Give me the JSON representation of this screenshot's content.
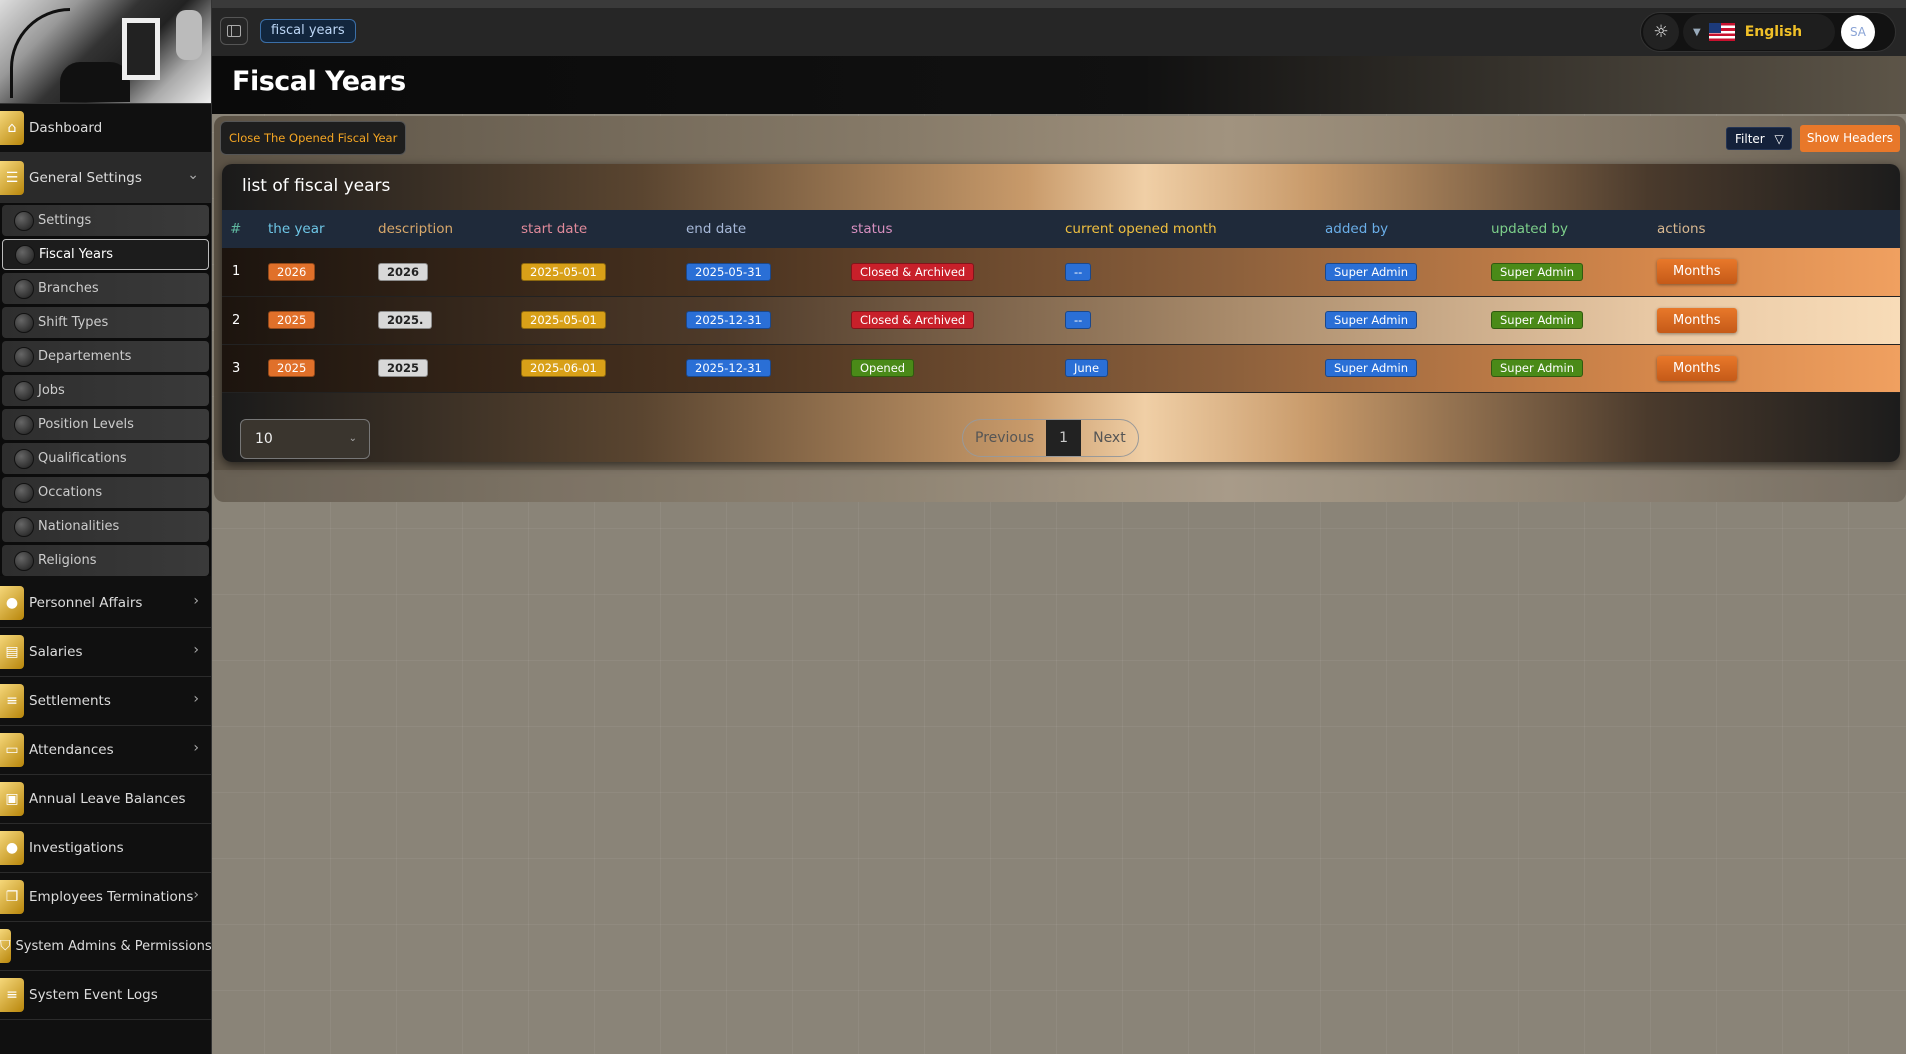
{
  "sidebar": {
    "items": [
      {
        "label": "Dashboard",
        "icon": "home-icon"
      },
      {
        "label": "General Settings",
        "icon": "sliders-icon",
        "expanded": true
      },
      {
        "label": "Personnel Affairs",
        "icon": "users-icon"
      },
      {
        "label": "Salaries",
        "icon": "money-icon"
      },
      {
        "label": "Settlements",
        "icon": "list-icon"
      },
      {
        "label": "Attendances",
        "icon": "briefcase-icon"
      },
      {
        "label": "Annual Leave Balances",
        "icon": "bag-icon"
      },
      {
        "label": "Investigations",
        "icon": "circle-icon"
      },
      {
        "label": "Employees Terminations",
        "icon": "copy-icon"
      },
      {
        "label": "System Admins & Permissions",
        "icon": "shield-icon"
      },
      {
        "label": "System Event Logs",
        "icon": "list-icon"
      }
    ],
    "subitems": [
      "Settings",
      "Fiscal Years",
      "Branches",
      "Shift Types",
      "Departements",
      "Jobs",
      "Position Levels",
      "Qualifications",
      "Occations",
      "Nationalities",
      "Religions"
    ],
    "active_subitem": "Fiscal Years"
  },
  "header": {
    "breadcrumb": "fiscal years",
    "language": "English",
    "avatar_initials": "SA"
  },
  "page": {
    "title": "Fiscal Years",
    "close_button": "Close The Opened Fiscal Year",
    "filter_button": "Filter",
    "show_headers_button": "Show Headers"
  },
  "table": {
    "title": "list of fiscal years",
    "columns": [
      {
        "label": "#",
        "color": "#5fb8a0"
      },
      {
        "label": "the year",
        "color": "#6ec6e6"
      },
      {
        "label": "description",
        "color": "#d8a86a"
      },
      {
        "label": "start date",
        "color": "#e08a9a"
      },
      {
        "label": "end date",
        "color": "#a6b8d8"
      },
      {
        "label": "status",
        "color": "#d890c0"
      },
      {
        "label": "current opened month",
        "color": "#f0c040"
      },
      {
        "label": "added by",
        "color": "#6aaee8"
      },
      {
        "label": "updated by",
        "color": "#7ccf8a"
      },
      {
        "label": "actions",
        "color": "#d8b890"
      }
    ],
    "rows": [
      {
        "num": "1",
        "year": "2026",
        "description": "2026",
        "start": "2025-05-01",
        "end": "2025-05-31",
        "status": "Closed & Archived",
        "status_color": "red",
        "month": "--",
        "added_by": "Super Admin",
        "updated_by": "Super Admin",
        "action": "Months"
      },
      {
        "num": "2",
        "year": "2025",
        "description": "2025.",
        "start": "2025-05-01",
        "end": "2025-12-31",
        "status": "Closed & Archived",
        "status_color": "red",
        "month": "--",
        "added_by": "Super Admin",
        "updated_by": "Super Admin",
        "action": "Months"
      },
      {
        "num": "3",
        "year": "2025",
        "description": "2025",
        "start": "2025-06-01",
        "end": "2025-12-31",
        "status": "Opened",
        "status_color": "green",
        "month": "June",
        "added_by": "Super Admin",
        "updated_by": "Super Admin",
        "action": "Months"
      }
    ]
  },
  "pagination": {
    "page_size": "10",
    "previous": "Previous",
    "current": "1",
    "next": "Next"
  }
}
